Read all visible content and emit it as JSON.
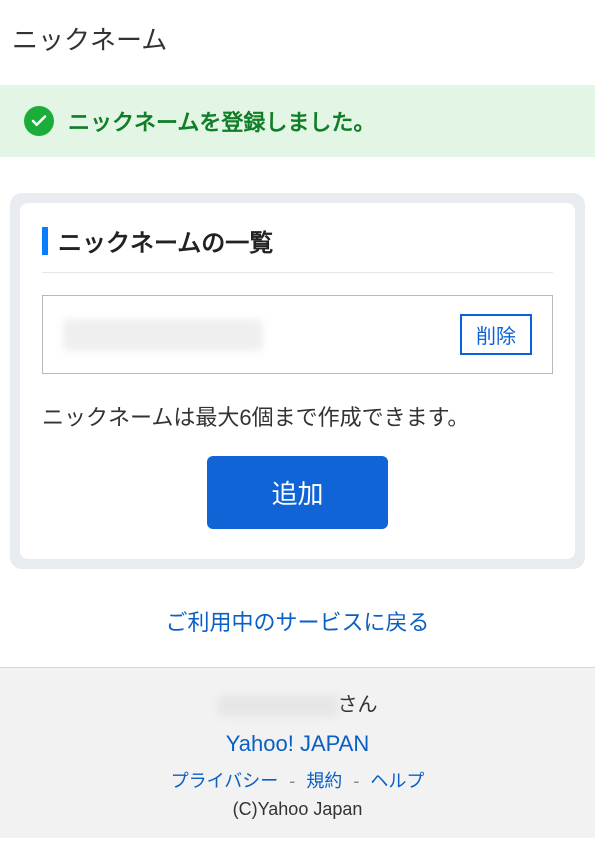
{
  "page": {
    "title": "ニックネーム"
  },
  "alert": {
    "message": "ニックネームを登録しました。"
  },
  "list": {
    "header": "ニックネームの一覧",
    "delete_label": "削除",
    "help_text": "ニックネームは最大6個まで作成できます。",
    "add_label": "追加"
  },
  "nav": {
    "back_link": "ご利用中のサービスに戻る"
  },
  "footer": {
    "user_suffix": "さん",
    "brand": "Yahoo! JAPAN",
    "privacy": "プライバシー",
    "terms": "規約",
    "help": "ヘルプ",
    "sep": "-",
    "copyright": "(C)Yahoo Japan"
  }
}
